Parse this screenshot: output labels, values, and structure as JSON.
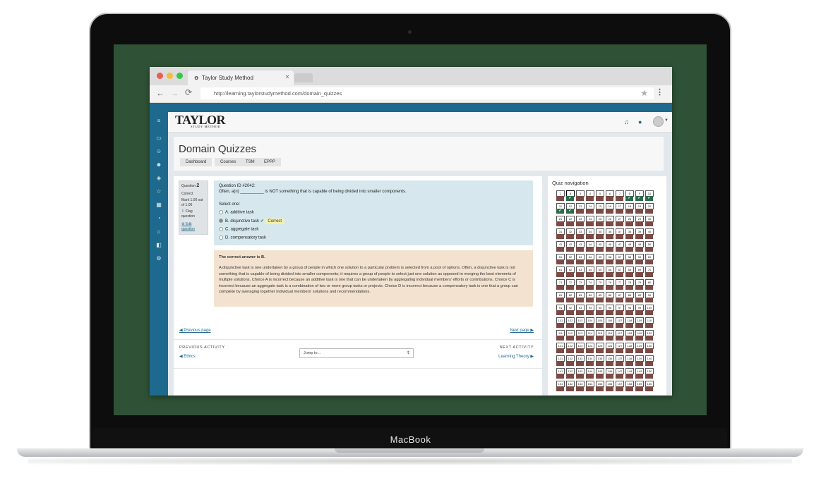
{
  "device": {
    "label": "MacBook"
  },
  "browser": {
    "tab_title": "Taylor Study Method",
    "tab_close": "×",
    "url": "http://learning.taylorstudymethod.com/domain_quizzes",
    "back": "←",
    "forward": "→",
    "reload": "⟳",
    "star": "★",
    "menu": "⋮",
    "traffic_colors": [
      "#ee5a52",
      "#f4bd3a",
      "#33c748"
    ]
  },
  "brand": {
    "logo_main": "TAYLOR",
    "logo_sub": "STUDY METHOD",
    "logo_tag": "A TRUE COMPANY",
    "primary_color": "#1d6a8e"
  },
  "sidebar_icons": [
    "menu-icon",
    "folder-icon",
    "users-icon",
    "user-icon",
    "layers-icon",
    "star-icon",
    "calendar-icon",
    "dashboard-icon",
    "home-icon",
    "book-icon",
    "settings-icon"
  ],
  "page": {
    "title": "Domain Quizzes",
    "breadcrumbs": [
      "Dashboard",
      "Courses",
      "TSM",
      "EPPP"
    ]
  },
  "question_info": {
    "label": "Question",
    "number": "2",
    "state": "Correct",
    "mark": "Mark 1.00 out of 1.00",
    "flag": "Flag question",
    "edit": "Edit question"
  },
  "question": {
    "id_line": "Question ID #2042:",
    "text": "Often, a(n) __________ is NOT something that is capable of being divided into smaller components.",
    "select_label": "Select one:",
    "options": [
      "A. additive task",
      "B. disjunctive task",
      "C. aggregate task",
      "D. compensatory task"
    ],
    "selected_index": 1,
    "correct_badge": "Correct"
  },
  "feedback": {
    "answer": "The correct answer is B.",
    "explanation": "A disjunctive task is one undertaken by a group of people in which one solution to a particular problem is selected from a pool of options. Often, a disjunctive task is not something that is capable of being divided into smaller components; it requires a group of people to select just one solution as opposed to merging the best elements of multiple solutions. Choice A is incorrect because an additive task is one that can be undertaken by aggregating individual members' efforts or contributions. Choice C is incorrect because an aggregate task is a combination of two or more group tasks or projects. Choice D is incorrect because a compensatory task is one that a group can complete by averaging together individual members' solutions and recommendations."
  },
  "paging": {
    "prev": "◀ Previous page",
    "next": "Next page ▶"
  },
  "activity": {
    "prev_heading": "PREVIOUS ACTIVITY",
    "prev_link": "◀ Ethics",
    "jump_placeholder": "Jump to...",
    "next_heading": "NEXT ACTIVITY",
    "next_link": "Learning Theory ▶"
  },
  "quiz_nav": {
    "title": "Quiz navigation",
    "total_visible": 160,
    "current": 2,
    "answered_correct": [
      2,
      8,
      9,
      10,
      11,
      12
    ],
    "colors": {
      "unanswered": "#7b4a44",
      "correct": "#2d6a49"
    }
  }
}
